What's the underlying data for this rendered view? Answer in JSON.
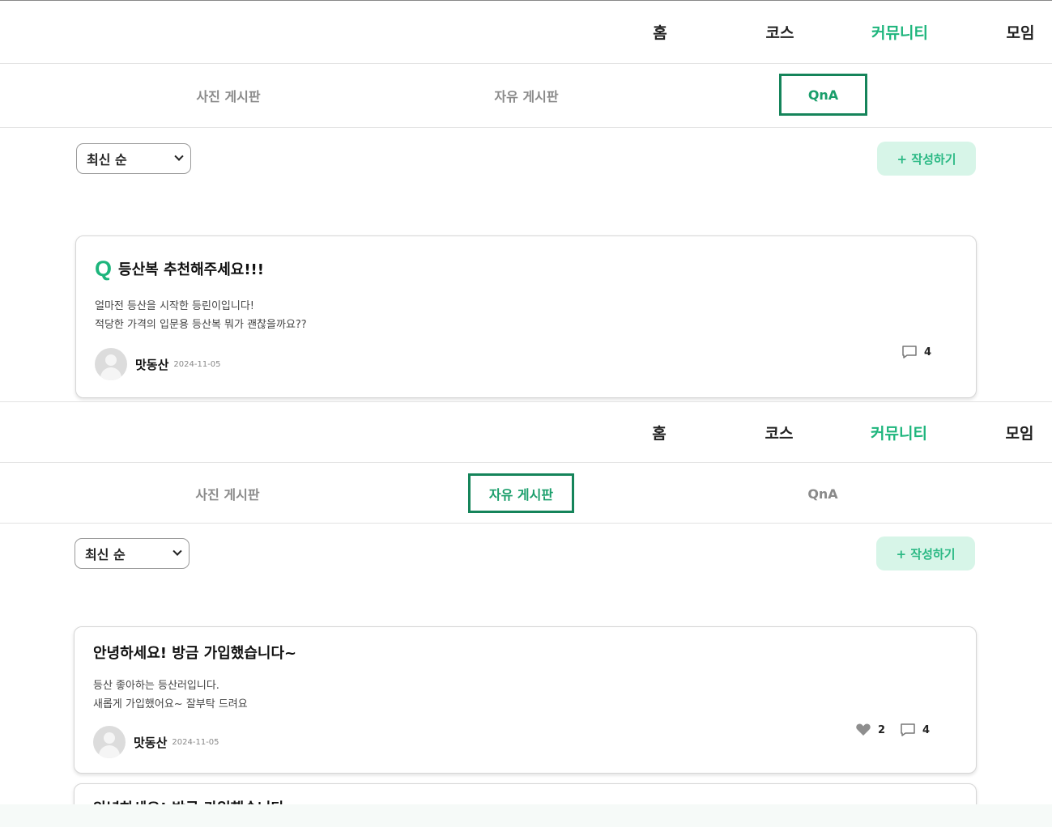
{
  "colors": {
    "accent": "#1db57c",
    "accent_dark": "#15845a",
    "button_bg": "#d7f5e8"
  },
  "panels": [
    {
      "nav": [
        "홈",
        "코스",
        "커뮤니티",
        "모임"
      ],
      "active_nav": "커뮤니티",
      "tabs": [
        "사진 게시판",
        "자유 게시판",
        "QnA"
      ],
      "active_tab": "QnA",
      "sort": {
        "value": "최신 순"
      },
      "write_label": "+ 작성하기",
      "posts": [
        {
          "prefix": "Q",
          "title": "등산복 추천해주세요!!!",
          "body": [
            "얼마전 등산을 시작한 등린이입니다!",
            "적당한 가격의 입문용 등산복 뭐가 괜찮을까요??"
          ],
          "author": "맛동산",
          "date": "2024-11-05",
          "comments": "4"
        }
      ]
    },
    {
      "nav": [
        "홈",
        "코스",
        "커뮤니티",
        "모임"
      ],
      "active_nav": "커뮤니티",
      "tabs": [
        "사진 게시판",
        "자유 게시판",
        "QnA"
      ],
      "active_tab": "자유 게시판",
      "sort": {
        "value": "최신 순"
      },
      "write_label": "+ 작성하기",
      "posts": [
        {
          "title": "안녕하세요! 방금 가입했습니다~",
          "body": [
            "등산 좋아하는 등산러입니다.",
            "새롭게 가입했어요~ 잘부탁 드려요"
          ],
          "author": "맛동산",
          "date": "2024-11-05",
          "likes": "2",
          "comments": "4"
        },
        {
          "title": "안녕하세요! 방금 가입했습니다~"
        }
      ]
    }
  ]
}
